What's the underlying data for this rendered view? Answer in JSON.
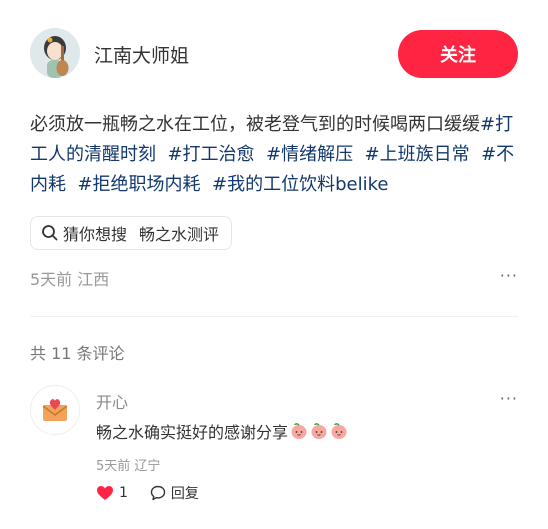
{
  "author": {
    "name": "江南大师姐",
    "avatar_icon": "avatar-illustration",
    "follow_label": "关注",
    "follow_color": "#ff2442"
  },
  "post": {
    "text": "必须放一瓶畅之水在工位，被老登气到的时候喝两口缓缓",
    "tags": [
      "#打工人的清醒时刻",
      "#打工治愈",
      "#情绪解压",
      "#上班族日常",
      "#不内耗",
      "#拒绝职场内耗",
      "#我的工位饮料belike"
    ],
    "tag_color": "#13386c",
    "search_prefix": "猜你想搜",
    "search_term": "畅之水测评",
    "search_icon": "search-icon",
    "meta": "5天前 江西",
    "more_label": "···"
  },
  "comments": {
    "count_label": "共 11 条评论",
    "items": [
      {
        "name": "开心",
        "avatar_icon": "heart-envelope-icon",
        "text": "畅之水确实挺好的感谢分享",
        "emoji_icon": "peach-emoji-icon",
        "emoji_count": 3,
        "meta": "5天前 辽宁",
        "like_count": "1",
        "reply_label": "回复",
        "more_label": "···"
      }
    ]
  }
}
